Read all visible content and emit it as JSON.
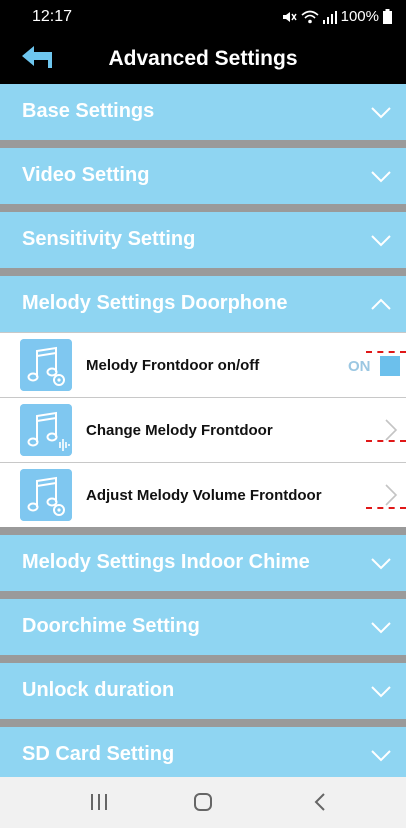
{
  "status": {
    "time": "12:17",
    "battery": "100%",
    "icons": [
      "mute-icon",
      "wifi-icon",
      "signal-icon",
      "battery-icon"
    ]
  },
  "header": {
    "title": "Advanced Settings",
    "back_icon": "back-arrow-icon"
  },
  "sections": [
    {
      "label": "Base Settings",
      "expanded": false
    },
    {
      "label": "Video Setting",
      "expanded": false
    },
    {
      "label": "Sensitivity Setting",
      "expanded": false
    },
    {
      "label": "Melody Settings Doorphone",
      "expanded": true
    },
    {
      "label": "Melody Settings Indoor Chime",
      "expanded": false
    },
    {
      "label": "Doorchime Setting",
      "expanded": false
    },
    {
      "label": "Unlock duration",
      "expanded": false
    },
    {
      "label": "SD Card Setting",
      "expanded": false
    }
  ],
  "melody_items": [
    {
      "label": "Melody Frontdoor on/off",
      "control": "toggle",
      "toggle_text": "ON",
      "icon": "music-note-gear-icon"
    },
    {
      "label": "Change Melody Frontdoor",
      "control": "chevron",
      "icon": "music-note-sound-icon"
    },
    {
      "label": "Adjust Melody Volume Frontdoor",
      "control": "chevron",
      "icon": "music-note-gear-icon"
    }
  ],
  "colors": {
    "section_bg": "#8fd5f2",
    "divider": "#9a9a9a",
    "icon_bg": "#7fc7f0",
    "toggle_knob": "#6cc0ec",
    "annotation_dash": "#e01818"
  },
  "nav": {
    "icons": [
      "recents-icon",
      "home-icon",
      "back-icon"
    ]
  }
}
